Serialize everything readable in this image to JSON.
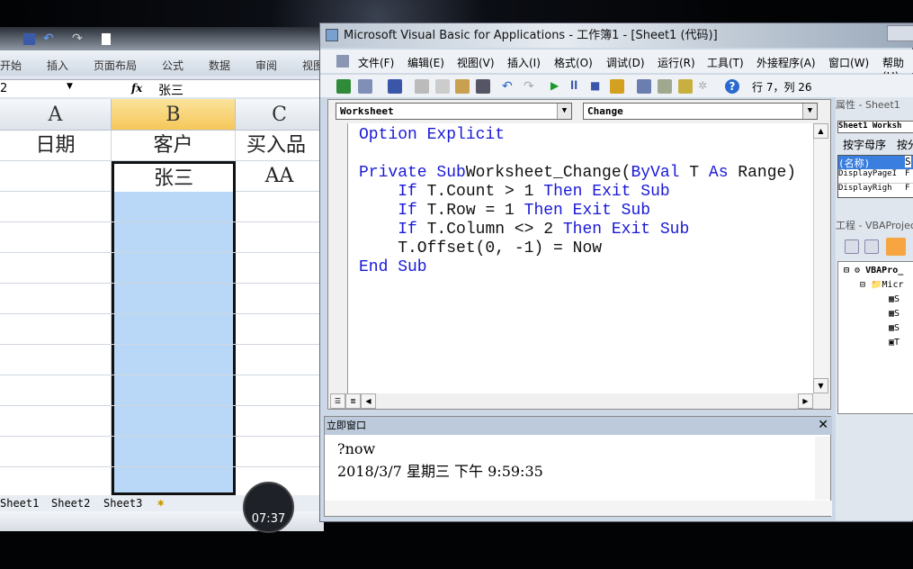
{
  "excel": {
    "ribbon_tabs": [
      "开始",
      "插入",
      "页面布局",
      "公式",
      "数据",
      "审阅",
      "视图"
    ],
    "name_box": "2",
    "fx": "fx",
    "formula": "张三",
    "columns": [
      "A",
      "B",
      "C"
    ],
    "rows": [
      [
        "日期",
        "客户",
        "买入品"
      ],
      [
        "",
        "张三",
        "AA"
      ]
    ],
    "sheet_tabs": [
      "Sheet1",
      "Sheet2",
      "Sheet3"
    ]
  },
  "timer": "07:37",
  "vba": {
    "title": "Microsoft Visual Basic for Applications - 工作簿1 - [Sheet1 (代码)]",
    "menu": [
      "文件(F)",
      "编辑(E)",
      "视图(V)",
      "插入(I)",
      "格式(O)",
      "调试(D)",
      "运行(R)",
      "工具(T)",
      "外接程序(A)",
      "窗口(W)",
      "帮助(H)"
    ],
    "cursor_pos": "行 7，列 26",
    "object_combo": "Worksheet",
    "proc_combo": "Change",
    "code": [
      [
        [
          "kw",
          "Option Explicit"
        ]
      ],
      [],
      [
        [
          "kw",
          "Private Sub"
        ],
        [
          "",
          "Worksheet_Change("
        ],
        [
          "kw",
          "ByVal"
        ],
        [
          "",
          " T "
        ],
        [
          "kw",
          "As"
        ],
        [
          "",
          " Range)"
        ]
      ],
      [
        [
          "",
          "    "
        ],
        [
          "kw",
          "If"
        ],
        [
          "",
          " T.Count > 1 "
        ],
        [
          "kw",
          "Then Exit Sub"
        ]
      ],
      [
        [
          "",
          "    "
        ],
        [
          "kw",
          "If"
        ],
        [
          "",
          " T.Row = 1 "
        ],
        [
          "kw",
          "Then Exit Sub"
        ]
      ],
      [
        [
          "",
          "    "
        ],
        [
          "kw",
          "If"
        ],
        [
          "",
          " T.Column <> 2 "
        ],
        [
          "kw",
          "Then Exit Sub"
        ]
      ],
      [
        [
          "",
          "    T.Offset(0, -1) = Now"
        ]
      ],
      [
        [
          "kw",
          "End Sub"
        ]
      ]
    ],
    "immediate_title": "立即窗口",
    "immediate_lines": [
      "?now",
      "2018/3/7 星期三 下午 9:59:35"
    ],
    "properties_title": "属性 - Sheet1",
    "properties_object": "Sheet1 Worksh",
    "properties_tabs": [
      "按字母序",
      "按分"
    ],
    "properties_rows": [
      [
        "(名称)",
        "S"
      ],
      [
        "DisplayPageI",
        "F"
      ],
      [
        "DisplayRigh",
        "F"
      ]
    ],
    "project_title": "工程 - VBAProjec",
    "project_tree": [
      "VBAPro_",
      "Micr",
      "S",
      "S",
      "S",
      "T"
    ]
  }
}
